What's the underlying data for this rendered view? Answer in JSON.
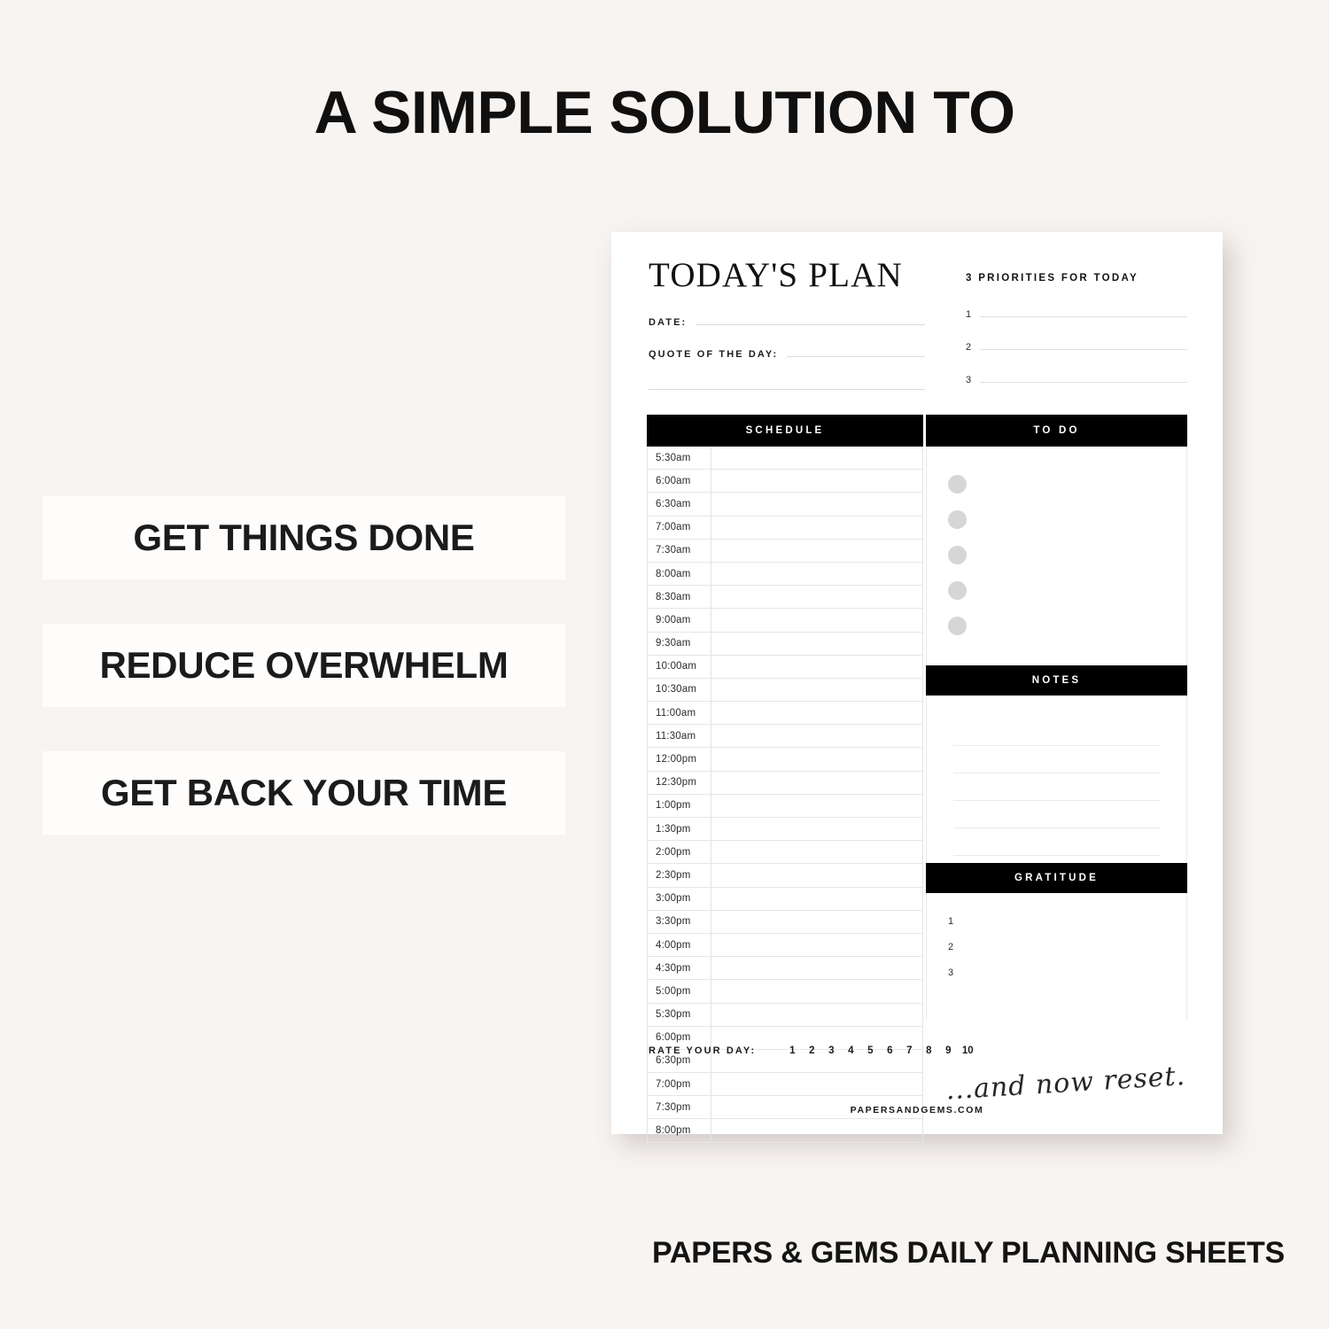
{
  "headline": "A SIMPLE SOLUTION TO",
  "benefits": [
    {
      "label": "GET THINGS DONE"
    },
    {
      "label": "REDUCE OVERWHELM"
    },
    {
      "label": "GET BACK YOUR TIME"
    }
  ],
  "bottom_caption": "PAPERS & GEMS DAILY PLANNING SHEETS",
  "planner": {
    "title": "TODAY'S PLAN",
    "date_label": "DATE:",
    "date_value": "",
    "quote_label": "QUOTE OF THE DAY:",
    "quote_value": "",
    "priorities": {
      "title": "3 PRIORITIES FOR TODAY",
      "items": [
        {
          "num": "1",
          "value": ""
        },
        {
          "num": "2",
          "value": ""
        },
        {
          "num": "3",
          "value": ""
        }
      ]
    },
    "bands": {
      "schedule": "SCHEDULE",
      "todo": "TO DO",
      "notes": "NOTES",
      "gratitude": "GRATITUDE"
    },
    "schedule_times": [
      "5:30am",
      "6:00am",
      "6:30am",
      "7:00am",
      "7:30am",
      "8:00am",
      "8:30am",
      "9:00am",
      "9:30am",
      "10:00am",
      "10:30am",
      "11:00am",
      "11:30am",
      "12:00pm",
      "12:30pm",
      "1:00pm",
      "1:30pm",
      "2:00pm",
      "2:30pm",
      "3:00pm",
      "3:30pm",
      "4:00pm",
      "4:30pm",
      "5:00pm",
      "5:30pm",
      "6:00pm",
      "6:30pm",
      "7:00pm",
      "7:30pm",
      "8:00pm"
    ],
    "todo_items_count": 5,
    "notes_lines_count": 5,
    "gratitude_items": [
      {
        "num": "1",
        "value": ""
      },
      {
        "num": "2",
        "value": ""
      },
      {
        "num": "3",
        "value": ""
      }
    ],
    "rate": {
      "label": "RATE YOUR DAY:",
      "scale": [
        "1",
        "2",
        "3",
        "4",
        "5",
        "6",
        "7",
        "8",
        "9",
        "10"
      ]
    },
    "script_text": "...and now reset.",
    "website": "PAPERSANDGEMS.COM"
  },
  "colors": {
    "background": "#f8f4f1",
    "sheet": "#ffffff",
    "band": "#000000",
    "text": "#111010",
    "dot": "#d6d6d6",
    "rule": "#e8e6e4"
  }
}
